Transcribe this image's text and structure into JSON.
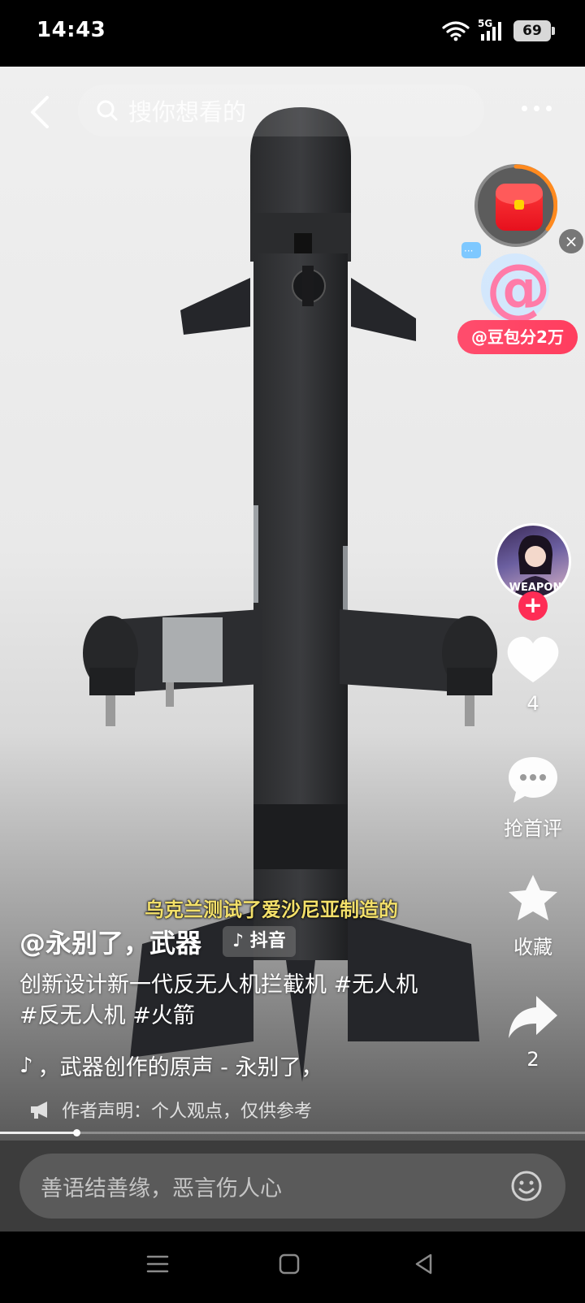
{
  "status_bar": {
    "time": "14:43",
    "network": "5G",
    "battery": "69"
  },
  "top_bar": {
    "search_placeholder": "搜你想看的"
  },
  "promo": {
    "badge": "@豆包分2万"
  },
  "rail": {
    "avatar_text": "WEAPON",
    "likes": "4",
    "comments": "抢首评",
    "favorites": "收藏",
    "shares": "2"
  },
  "video": {
    "subtitle": "乌克兰测试了爱沙尼亚制造的",
    "author": "@永别了，武器",
    "platform_tag": "抖音",
    "description": "创新设计新一代反无人机拦截机 #无人机 #反无人机 #火箭",
    "music": "，武器创作的原声 - 永别了，",
    "disclaimer": "作者声明：个人观点，仅供参考",
    "progress": 0.13
  },
  "comment_bar": {
    "placeholder": "善语结善缘，恶言伤人心"
  },
  "colors": {
    "accent": "#fe2c55",
    "subtitle": "#f3e06a",
    "comment_bg": "#3c3c3c"
  }
}
